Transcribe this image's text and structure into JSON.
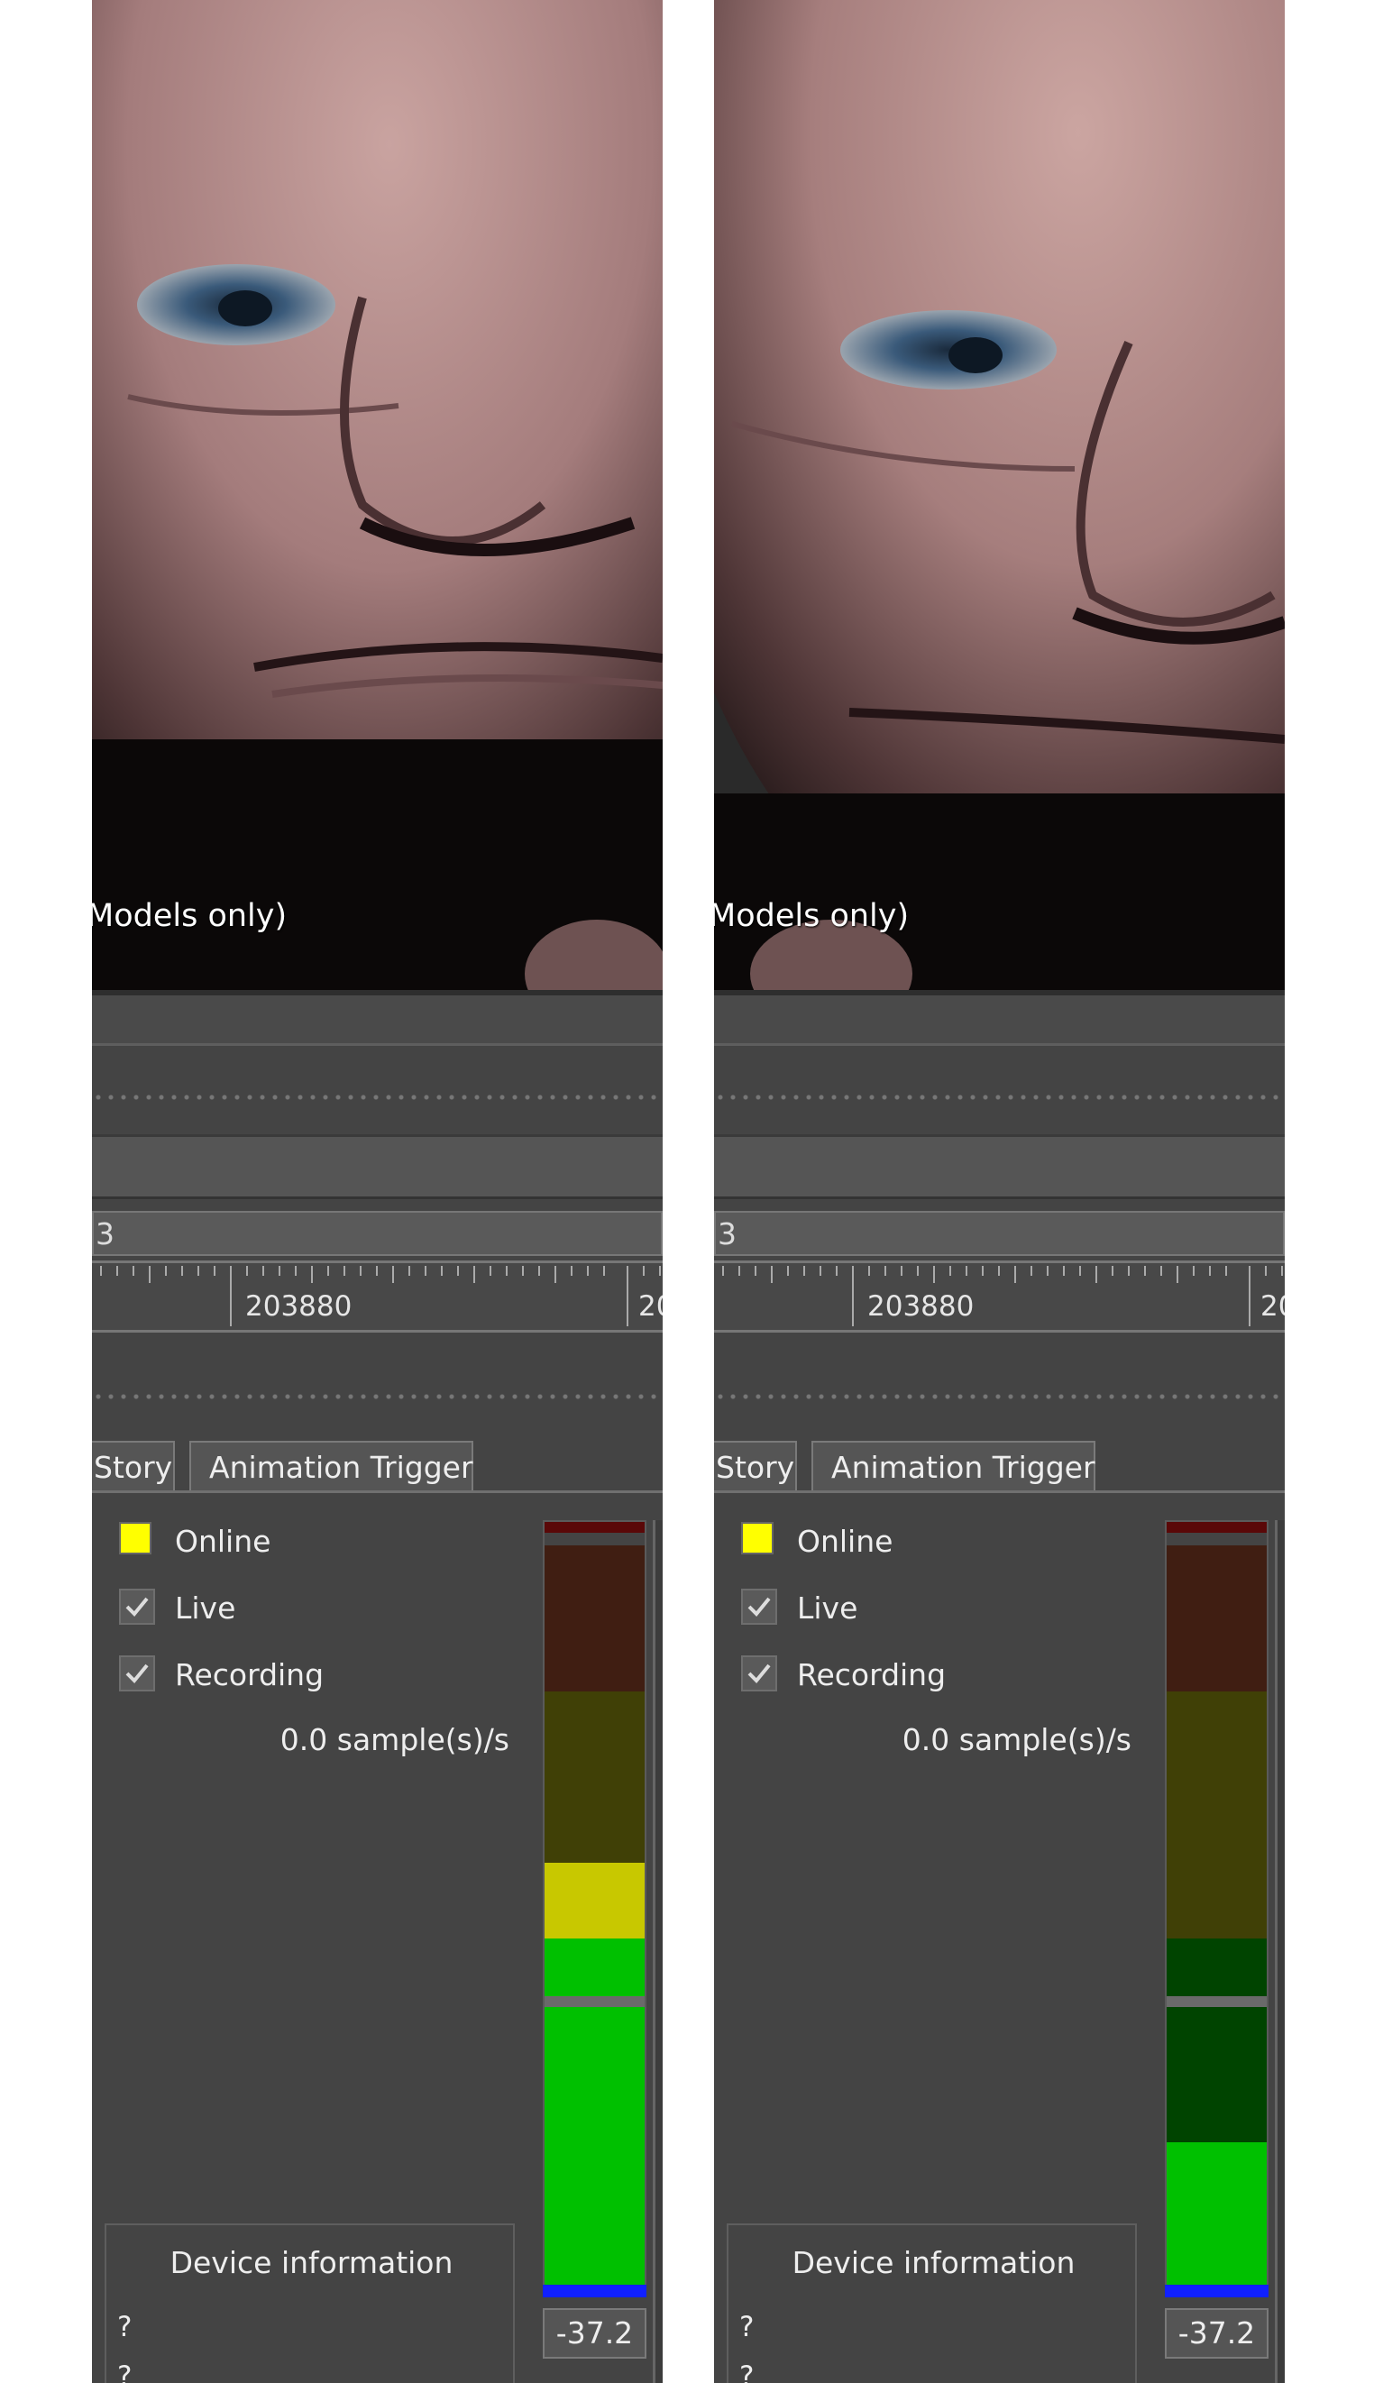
{
  "viewport": {
    "label": "Models only)"
  },
  "timeline": {
    "frame_field": "3",
    "ruler_label_1": "203880",
    "ruler_label_2": "20"
  },
  "tabs": {
    "story": "Story",
    "animation_trigger": "Animation Trigger"
  },
  "status": {
    "online": "Online",
    "online_color": "#ffff00",
    "live": "Live",
    "recording": "Recording",
    "rate": "0.0 sample(s)/s"
  },
  "meter": {
    "value": "-37.2"
  },
  "device": {
    "title": "Device information",
    "line1": "?",
    "line2": "?"
  }
}
